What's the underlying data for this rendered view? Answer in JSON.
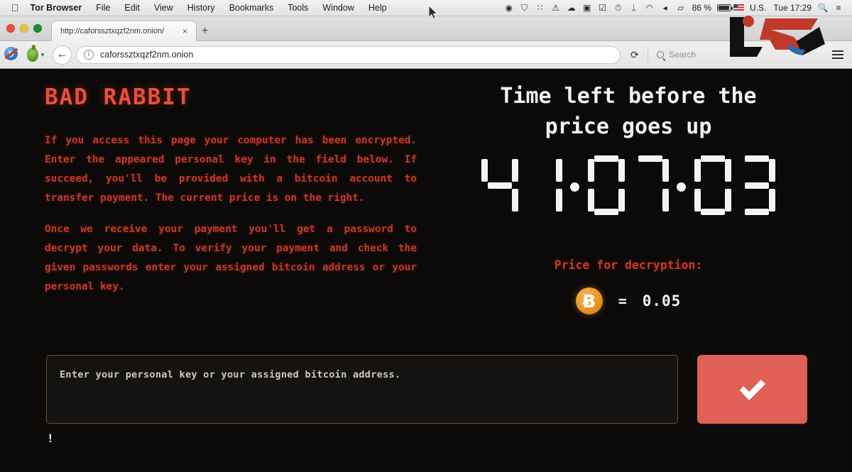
{
  "menubar": {
    "apple_icon": "apple-logo",
    "app_name": "Tor Browser",
    "menus": [
      "File",
      "Edit",
      "View",
      "History",
      "Bookmarks",
      "Tools",
      "Window",
      "Help"
    ],
    "status_icons": [
      {
        "name": "record-icon",
        "glyph": "◉"
      },
      {
        "name": "shield-icon",
        "glyph": "⛉"
      },
      {
        "name": "dropbox-icon",
        "glyph": "∷"
      },
      {
        "name": "alert-triangle-icon",
        "glyph": "⚠"
      },
      {
        "name": "cloud-icon",
        "glyph": "☁"
      },
      {
        "name": "screen-icon",
        "glyph": "▣"
      },
      {
        "name": "checkbox-icon",
        "glyph": "☑"
      },
      {
        "name": "time-machine-icon",
        "glyph": "⏱"
      },
      {
        "name": "bluetooth-icon",
        "glyph": "ᛦ"
      },
      {
        "name": "wifi-icon",
        "glyph": "◠"
      },
      {
        "name": "volume-icon",
        "glyph": "◂"
      },
      {
        "name": "airplay-icon",
        "glyph": "▱"
      }
    ],
    "battery_percent": "86 %",
    "input_source": "U.S.",
    "clock": "Tue 17:29",
    "search_icon": "spotlight-search-icon",
    "notification_icon": "notification-center-icon"
  },
  "browser": {
    "window_controls": [
      "close",
      "minimize",
      "zoom"
    ],
    "tab_title": "http://caforssztxqzf2nm.onion/",
    "tab_close_glyph": "×",
    "new_tab_glyph": "+",
    "extensions": [
      {
        "name": "noscript-icon",
        "label": "S"
      },
      {
        "name": "torbutton-onion-icon",
        "label": ""
      }
    ],
    "back_glyph": "←",
    "url_value": "caforssztxqzf2nm.onion",
    "url_info_glyph": "i",
    "reload_glyph": "⟳",
    "search_placeholder": "Search",
    "menu_icon": "hamburger-menu-icon",
    "watermark": "news-site-logo-watermark"
  },
  "ransom": {
    "title": "BAD RABBIT",
    "paragraphs": [
      "If you access this page your computer has been encrypted. Enter the appeared personal key in the field below. If succeed, you'll be provided with a bitcoin account to transfer payment. The current price is on the right.",
      "Once we receive your payment you'll get a password to decrypt your data. To verify your payment and check the given passwords enter your assigned bitcoin address or your personal key."
    ],
    "timer_heading_line1": "Time left before the",
    "timer_heading_line2": "price goes up",
    "countdown": {
      "display": "41:07:03",
      "hours": "41",
      "minutes": "07",
      "seconds": "03",
      "separator": "·"
    },
    "price_label": "Price for decryption:",
    "bitcoin_icon": "bitcoin-coin-icon",
    "bitcoin_glyph": "Ƀ",
    "equals": "=",
    "price_amount": "0.05",
    "input_placeholder": "Enter your personal key or your assigned bitcoin address.",
    "input_value": "",
    "submit_icon": "checkmark-icon",
    "bottom_caret": "!"
  },
  "colors": {
    "page_background": "#0b0a09",
    "title_red": "#e8503a",
    "body_red": "#c4392c",
    "segment_white": "#f4f4f4",
    "bitcoin_orange": "#e8901d",
    "submit_red": "#e06055",
    "input_border": "#6b5124"
  }
}
